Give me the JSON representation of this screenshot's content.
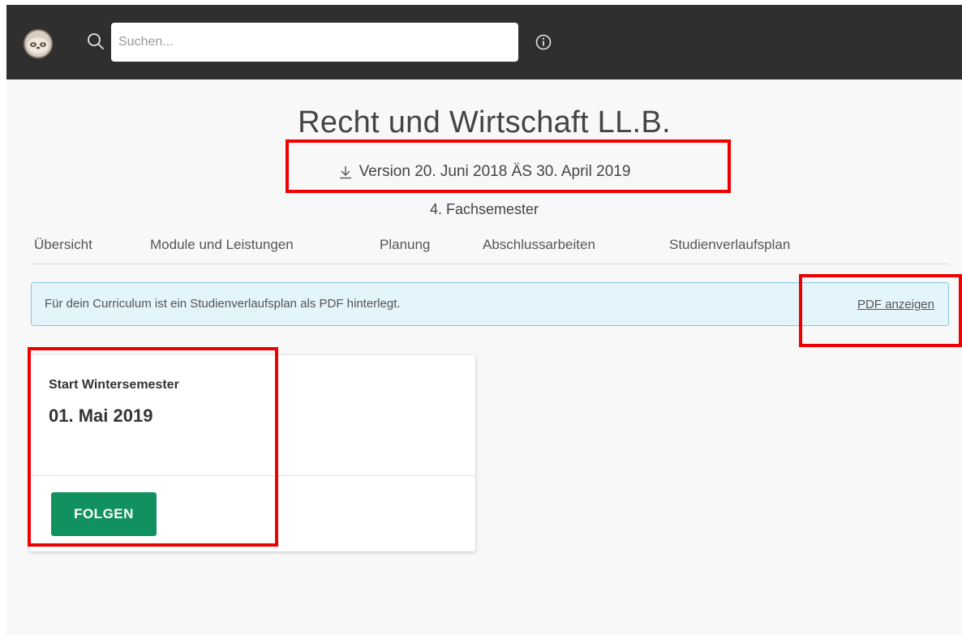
{
  "header": {
    "search_placeholder": "Suchen...",
    "avatar_icon": "sloth-avatar-icon",
    "search_icon": "search-icon",
    "info_icon": "info-icon"
  },
  "main": {
    "title": "Recht und Wirtschaft LL.B.",
    "version_icon": "download-icon",
    "version": "Version 20. Juni 2018 ÄS 30. April 2019",
    "semester": "4. Fachsemester",
    "tabs": [
      {
        "label": "Übersicht"
      },
      {
        "label": "Module und Leistungen"
      },
      {
        "label": "Planung"
      },
      {
        "label": "Abschlussarbeiten"
      },
      {
        "label": "Studienverlaufsplan"
      }
    ],
    "notice": {
      "text": "Für dein Curriculum ist ein Studienverlaufsplan als PDF hinterlegt.",
      "link": "PDF anzeigen"
    },
    "card": {
      "label": "Start Wintersemester",
      "date": "01. Mai 2019",
      "button": "FOLGEN"
    }
  },
  "colors": {
    "topbar": "#2f2f2f",
    "button": "#129160",
    "notice_bg": "#e3f4fb",
    "notice_border": "#86c9e6",
    "highlight": "#ee0000"
  }
}
